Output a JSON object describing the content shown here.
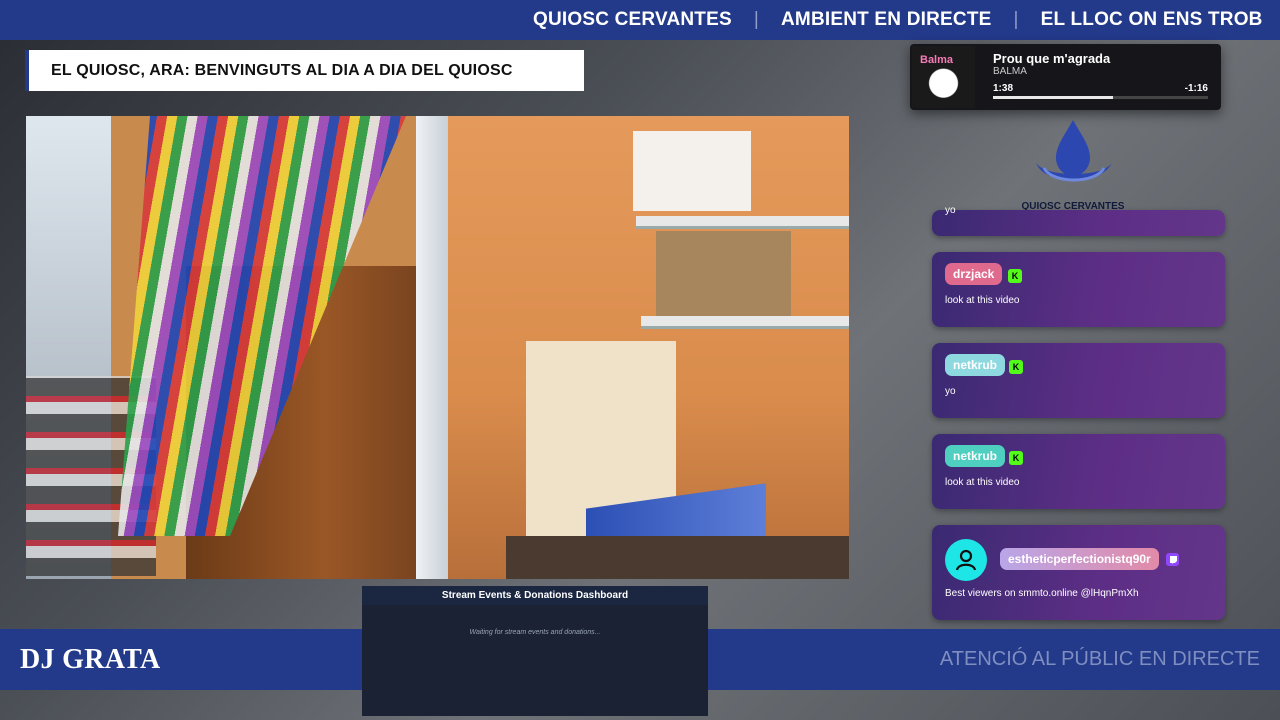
{
  "ticker_top": {
    "items": [
      "QUIOSC CERVANTES",
      "AMBIENT EN DIRECTE",
      "EL LLOC ON ENS TROB"
    ],
    "separator": "|"
  },
  "headline": "EL QUIOSC, ARA: BENVINGUTS AL DIA A DIA DEL QUIOSC",
  "now_playing": {
    "title": "Prou que m'agrada",
    "artist": "BALMA",
    "album_art_text": "Balma",
    "elapsed": "1:38",
    "remaining": "-1:16",
    "progress_fraction": 0.56
  },
  "logo": {
    "name": "QUIOSC CERVANTES"
  },
  "chat": {
    "messages": [
      {
        "message": "yo"
      },
      {
        "username": "drzjack",
        "message": "look at this video",
        "platform_icon": "kick-icon",
        "pill_color": "#e06a8e"
      },
      {
        "username": "netkrub",
        "message": "yo",
        "platform_icon": "kick-icon",
        "pill_color": "#8ed8e0"
      },
      {
        "username": "netkrub",
        "message": "look at this video",
        "platform_icon": "kick-icon",
        "pill_color": "#4fcfc0"
      },
      {
        "username": "estheticperfectionistq90r",
        "message": "Best viewers on smmto.online @lHqnPmXh",
        "platform_icon": "twitch-icon",
        "pill_color": "#d78ac4"
      }
    ]
  },
  "bottom_bar": {
    "dj_name": "DJ GRATA",
    "public_text": "ATENCIÓ AL PÚBLIC EN DIRECTE"
  },
  "dashboard": {
    "title": "Stream Events & Donations Dashboard",
    "status": "Waiting for stream events and donations..."
  },
  "colors": {
    "brand_blue": "#23398a",
    "chat_purple": "#5e2e86",
    "kick_green": "#53fc18",
    "twitch_purple": "#9146ff"
  }
}
